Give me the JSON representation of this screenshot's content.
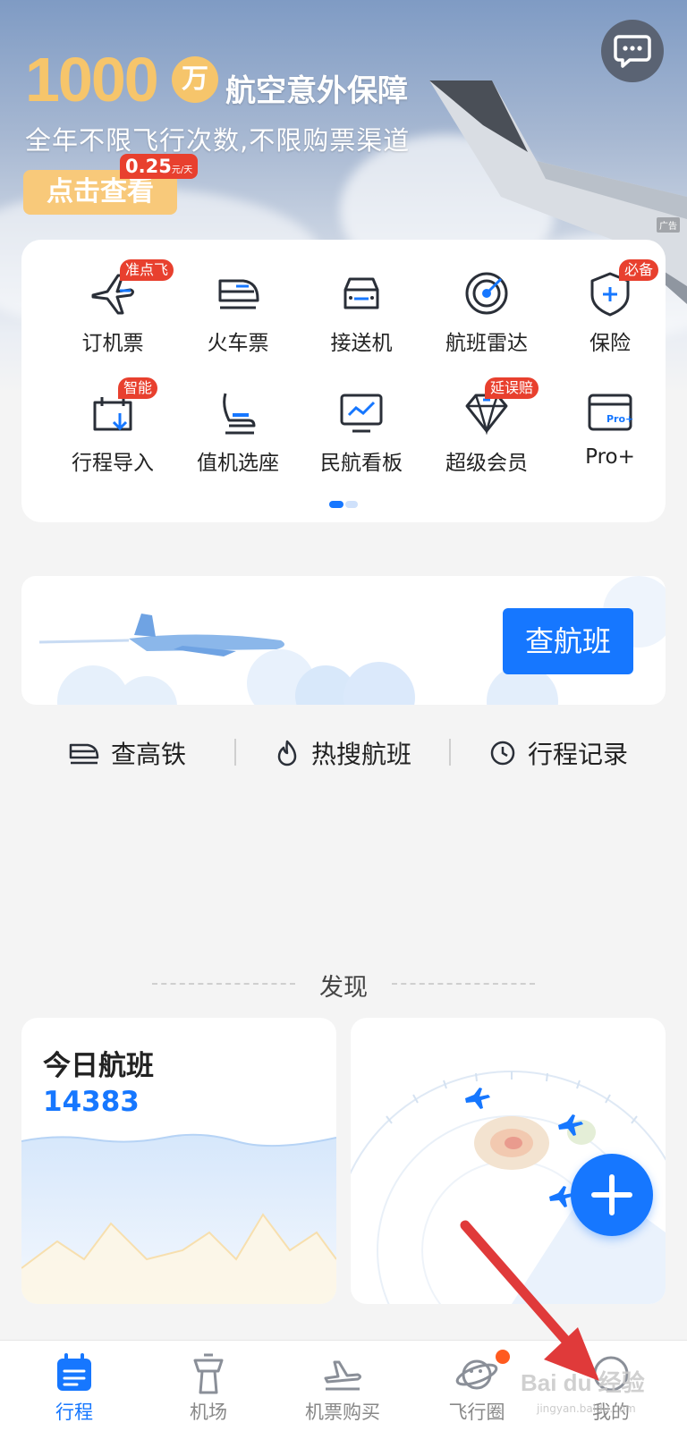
{
  "banner": {
    "big_number": "1000",
    "unit": "万",
    "title": "航空意外保障",
    "subtitle": "全年不限飞行次数,不限购票渠道",
    "button_label": "点击查看",
    "price": "0.25",
    "price_unit": "元/天",
    "ad_label": "广告"
  },
  "message_icon": "chat-bubble-icon",
  "services": [
    {
      "label": "订机票",
      "icon": "plane-icon",
      "tag": "准点飞"
    },
    {
      "label": "火车票",
      "icon": "train-icon",
      "tag": ""
    },
    {
      "label": "接送机",
      "icon": "car-icon",
      "tag": ""
    },
    {
      "label": "航班雷达",
      "icon": "radar-icon",
      "tag": ""
    },
    {
      "label": "保险",
      "icon": "shield-icon",
      "tag": "必备"
    },
    {
      "label": "行程导入",
      "icon": "import-icon",
      "tag": "智能"
    },
    {
      "label": "值机选座",
      "icon": "seat-icon",
      "tag": ""
    },
    {
      "label": "民航看板",
      "icon": "dashboard-icon",
      "tag": ""
    },
    {
      "label": "超级会员",
      "icon": "diamond-icon",
      "tag": "延误赔"
    },
    {
      "label": "Pro+",
      "icon": "pro-card-icon",
      "tag": ""
    }
  ],
  "flight_search": {
    "button_label": "查航班"
  },
  "quick_links": [
    {
      "label": "查高铁",
      "icon": "high-speed-rail-icon"
    },
    {
      "label": "热搜航班",
      "icon": "flame-icon"
    },
    {
      "label": "行程记录",
      "icon": "clock-icon"
    }
  ],
  "discover": {
    "title": "发现",
    "today_flights_label": "今日航班",
    "today_flights_count": "14383"
  },
  "bottom_nav": [
    {
      "label": "行程",
      "icon": "calendar-list-icon",
      "active": true
    },
    {
      "label": "机场",
      "icon": "control-tower-icon",
      "active": false
    },
    {
      "label": "机票购买",
      "icon": "plane-ticket-icon",
      "active": false
    },
    {
      "label": "飞行圈",
      "icon": "planet-icon",
      "active": false
    },
    {
      "label": "我的",
      "icon": "profile-icon",
      "active": false
    }
  ],
  "watermark": {
    "text": "Bai du 经验",
    "sub": "jingyan.baidu.com"
  },
  "colors": {
    "accent": "#1677ff",
    "tag_red": "#e8402e",
    "gold": "#f6c56b"
  }
}
